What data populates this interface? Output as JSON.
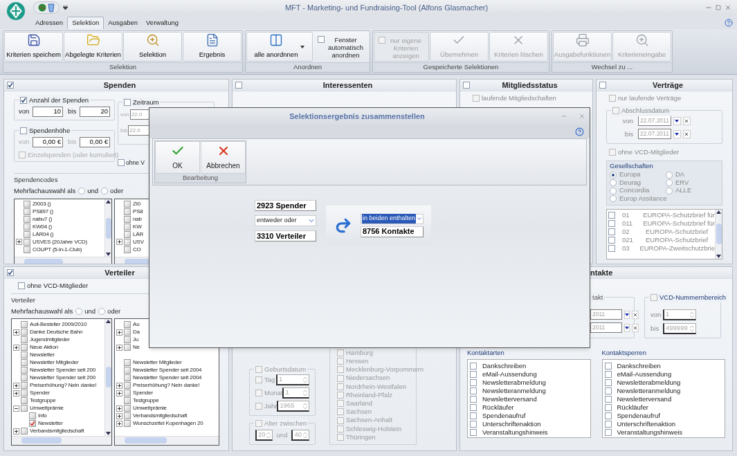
{
  "window": {
    "title": "MFT -  Marketing- und Fundraising-Tool (Alfons Glasmacher)"
  },
  "ribbon_tabs": [
    {
      "label": "Adressen",
      "selected": false
    },
    {
      "label": "Selektion",
      "selected": true
    },
    {
      "label": "Ausgaben",
      "selected": false
    },
    {
      "label": "Verwaltung",
      "selected": false
    }
  ],
  "ribbon_groups": [
    {
      "label": "Selektion",
      "items": [
        {
          "kind": "button",
          "label": "Kriterien speichem",
          "disabled": false
        },
        {
          "kind": "button",
          "label": "Abgelegte Kriterien",
          "disabled": false
        },
        {
          "kind": "button",
          "label": "Selektion",
          "disabled": false
        },
        {
          "kind": "button",
          "label": "Ergebnis",
          "disabled": false
        }
      ]
    },
    {
      "label": "Anordnen",
      "items": [
        {
          "kind": "split",
          "label": "alle anordnnen",
          "disabled": false
        },
        {
          "kind": "check",
          "label": "Fenster automatisch anordnen",
          "checked": false,
          "disabled": false
        }
      ]
    },
    {
      "label": "Gespeicherte Selektionen",
      "items": [
        {
          "kind": "check",
          "label": "nur eigene Kriterien anzeigen",
          "checked": false,
          "disabled": true
        },
        {
          "kind": "button",
          "label": "Übernehmen",
          "disabled": true
        },
        {
          "kind": "button",
          "label": "Kriterien löschen",
          "disabled": true
        }
      ]
    },
    {
      "label": "Wechsel zu ...",
      "items": [
        {
          "kind": "button",
          "label": "Ausgabefunktionen",
          "disabled": true
        },
        {
          "kind": "button",
          "label": "Kriterieneingabe",
          "disabled": true
        }
      ]
    }
  ],
  "spenden": {
    "title": "Spenden",
    "checked": true,
    "anzahl": {
      "label": "Anzahl der Spenden",
      "checked": true,
      "von_label": "von",
      "von": "10",
      "bis_label": "bis",
      "bis": "20"
    },
    "hoehe": {
      "label": "Spendenhöhe",
      "checked": false,
      "von_label": "von",
      "von": "0,00 €",
      "bis_label": "bis",
      "bis": "0,00 €",
      "einzel": {
        "label": "Einzelspenden (oder kumuliert)",
        "checked": false
      }
    },
    "zeitraum": {
      "label": "Zeitraum",
      "checked": false,
      "von_label": "von",
      "von": "22.0",
      "bis_label": "bis",
      "bis": "22.0"
    },
    "ohne": {
      "label": "ohne V",
      "checked": false
    },
    "codes": {
      "label": "Spendencodes",
      "mehrfach": "Mehrfachauswahl als",
      "options": [
        {
          "label": "und",
          "selected": false
        },
        {
          "label": "oder",
          "selected": false
        }
      ],
      "list": [
        {
          "label": "ZI003 ()",
          "checked": false
        },
        {
          "label": "PS897 ()",
          "checked": false
        },
        {
          "label": "nabu7 ()",
          "checked": false
        },
        {
          "label": "KW04 ()",
          "checked": false
        },
        {
          "label": "LÄR04 ()",
          "checked": false
        },
        {
          "label": "USVES (20Jahre VCD)",
          "checked": false,
          "expanded": false
        },
        {
          "label": "COUPT (5-in-1-Club)",
          "checked": false
        }
      ],
      "list2": [
        {
          "label": "ZI0",
          "checked": false
        },
        {
          "label": "PS8",
          "checked": false
        },
        {
          "label": "nab",
          "checked": false
        },
        {
          "label": "KW",
          "checked": false
        },
        {
          "label": "LÄR",
          "checked": false
        },
        {
          "label": "USV",
          "checked": false,
          "expanded": false
        },
        {
          "label": "CO",
          "checked": false
        }
      ]
    }
  },
  "verteiler": {
    "title": "Verteiler",
    "checked": true,
    "ohne": {
      "label": "ohne VCD-Mitglieder",
      "checked": false
    },
    "group": "Verteiler",
    "mehrfach": "Mehrfachauswahl als",
    "options": [
      {
        "label": "und",
        "selected": false
      },
      {
        "label": "oder",
        "selected": false
      }
    ],
    "list": [
      {
        "label": "Auli-Besteller 2009/2010",
        "checked": false
      },
      {
        "label": "Danke Deutsche Bahn",
        "checked": false,
        "expanded": false
      },
      {
        "label": "Jugendmitglieder",
        "checked": false
      },
      {
        "label": "Neue Aktion",
        "checked": false,
        "expanded": false
      },
      {
        "label": "Newsletter",
        "checked": false
      },
      {
        "label": "Newsletter Mitglieder",
        "checked": false
      },
      {
        "label": "Newsletter Spender seit 200",
        "checked": false
      },
      {
        "label": "Newsletter Spender seit 200",
        "checked": false
      },
      {
        "label": "Preiserhöhung? Nein danke!",
        "checked": false,
        "expanded": false
      },
      {
        "label": "Spender",
        "checked": false,
        "expanded": false
      },
      {
        "label": "Testgruppe",
        "checked": false
      },
      {
        "label": "Umweltprämie",
        "checked": false,
        "expanded": true,
        "children": [
          {
            "label": "Info",
            "checked": false
          },
          {
            "label": "Newsletter",
            "checked": true
          }
        ]
      },
      {
        "label": "Verbandsmitgliedschaft",
        "checked": false,
        "expanded": false
      }
    ],
    "list2_top": [
      {
        "label": "Au",
        "checked": false
      },
      {
        "label": "Da",
        "checked": false,
        "expanded": false
      },
      {
        "label": "Ju",
        "checked": false
      },
      {
        "label": "Ne",
        "checked": false,
        "expanded": false
      }
    ],
    "list2": [
      {
        "label": "Newsletter Mitglieder",
        "checked": false
      },
      {
        "label": "Newsletter Spender seit 2004",
        "checked": false
      },
      {
        "label": "Newsletter Spender seit 2004",
        "checked": false
      },
      {
        "label": "Preiserhöhung? Nein danke!",
        "checked": false,
        "expanded": false
      },
      {
        "label": "Spender",
        "checked": false,
        "expanded": false
      },
      {
        "label": "Testgruppe",
        "checked": false
      },
      {
        "label": "Umweltprämie",
        "checked": false,
        "expanded": false
      },
      {
        "label": "Verbandsmitgliedschaft",
        "checked": false,
        "expanded": false
      },
      {
        "label": "Wunschzettel Kopenhagen 20",
        "checked": false,
        "expanded": false
      }
    ]
  },
  "interessenten": {
    "title": "Interessenten",
    "checked": false,
    "geburtsdatum": {
      "label": "Geburtsdatum",
      "checked": false,
      "rows": [
        {
          "label": "Tag",
          "checked": false,
          "value": "1"
        },
        {
          "label": "Monat",
          "checked": false,
          "value": "1"
        },
        {
          "label": "Jahr",
          "checked": false,
          "value": "1965"
        }
      ]
    },
    "alter": {
      "label": "Alter zwischen",
      "checked": false,
      "von": "20",
      "und": "und",
      "bis": "40"
    },
    "states": [
      {
        "label": "Hamburg",
        "checked": false
      },
      {
        "label": "Hessen",
        "checked": false
      },
      {
        "label": "Mecklenburg-Vorpommern",
        "checked": false
      },
      {
        "label": "Niedersachsen",
        "checked": false
      },
      {
        "label": "Nordrhein-Westfalen",
        "checked": false
      },
      {
        "label": "Rheinland-Pfalz",
        "checked": false
      },
      {
        "label": "Saarland",
        "checked": false
      },
      {
        "label": "Sachsen",
        "checked": false
      },
      {
        "label": "Sachsen-Anhalt",
        "checked": false
      },
      {
        "label": "Schleswig-Holstein",
        "checked": false
      },
      {
        "label": "Thüringen",
        "checked": false
      }
    ]
  },
  "mitgliedsstatus": {
    "title": "Mitgliedsstatus",
    "checked": false,
    "options": [
      {
        "label": "laufende Mitgliedschaften",
        "checked": false
      }
    ]
  },
  "vertraege": {
    "title": "Verträge",
    "checked": false,
    "nur_laufende": {
      "label": "nur laufende Verträge",
      "checked": false
    },
    "abschluss": {
      "label": "Abschlussdatum",
      "checked": false,
      "von_label": "von",
      "von": "22.07.2011",
      "bis_label": "bis",
      "bis": "22.07.2011"
    },
    "ohne": {
      "label": "ohne VCD-Mitglieder",
      "checked": false
    },
    "gesellschaften": {
      "label": "Gesellschaften",
      "options": [
        {
          "label": "Europa",
          "selected": true
        },
        {
          "label": "DA",
          "selected": false
        },
        {
          "label": "Deurag",
          "selected": false
        },
        {
          "label": "ERV",
          "selected": false
        },
        {
          "label": "Concordia",
          "selected": false
        },
        {
          "label": "ALLE",
          "selected": false
        },
        {
          "label": "Europ Assitance",
          "selected": false
        }
      ]
    },
    "list": [
      {
        "code": "01",
        "name": "EUROPA-Schutzbrief für",
        "checked": false
      },
      {
        "code": "011",
        "name": "EUROPA-Schutzbrief für",
        "checked": false
      },
      {
        "code": "02",
        "name": "EUROPA-Schutzbrief",
        "checked": false
      },
      {
        "code": "021",
        "name": "EUROPA-Schutzbrief",
        "checked": false
      },
      {
        "code": "03",
        "name": "EUROPA-Zweitschutzbrie",
        "checked": false
      }
    ]
  },
  "kontakte": {
    "title": "ntakte",
    "letzter": {
      "label": "takt",
      "von": "2011",
      "bis": "2011"
    },
    "vcd": {
      "label": "VCD-Nummernbereich",
      "checked": false,
      "von_label": "von",
      "von": "1",
      "bis_label": "bis",
      "bis": "499999"
    },
    "arten": {
      "label": "Kontaktarten",
      "items": [
        {
          "label": "Dankschreiben",
          "checked": false
        },
        {
          "label": "eMail-Aussendung",
          "checked": false
        },
        {
          "label": "Newsletterabmeldung",
          "checked": false
        },
        {
          "label": "Newsletteranmeldung",
          "checked": false
        },
        {
          "label": "Newsletterversand",
          "checked": false
        },
        {
          "label": "Rückläufer",
          "checked": false
        },
        {
          "label": "Spendenaufruf",
          "checked": false
        },
        {
          "label": "Unterschriftenaktion",
          "checked": false
        },
        {
          "label": "Veranstaltungshinweis",
          "checked": false
        }
      ]
    },
    "sperren": {
      "label": "Kontaktsperren",
      "items": [
        {
          "label": "Dankschreiben",
          "checked": false
        },
        {
          "label": "eMail-Aussendung",
          "checked": false
        },
        {
          "label": "Newsletterabmeldung",
          "checked": false
        },
        {
          "label": "Newsletteranmeldung",
          "checked": false
        },
        {
          "label": "Newsletterversand",
          "checked": false
        },
        {
          "label": "Rückläufer",
          "checked": false
        },
        {
          "label": "Spendenaufruf",
          "checked": false
        },
        {
          "label": "Unterschriftenaktion",
          "checked": false
        },
        {
          "label": "Veranstaltungshinweis",
          "checked": false
        }
      ]
    }
  },
  "dialog": {
    "title": "Selektionsergebnis zusammenstellen",
    "buttons": [
      {
        "label": "OK"
      },
      {
        "label": "Abbrechen"
      }
    ],
    "group": "Bearbeitung",
    "spender": "2923 Spender",
    "operator": "entweder oder",
    "verteiler": "3310 Verteiler",
    "mode": {
      "value": "in beiden enthalten",
      "selected": true
    },
    "result": "8756 Kontakte"
  }
}
